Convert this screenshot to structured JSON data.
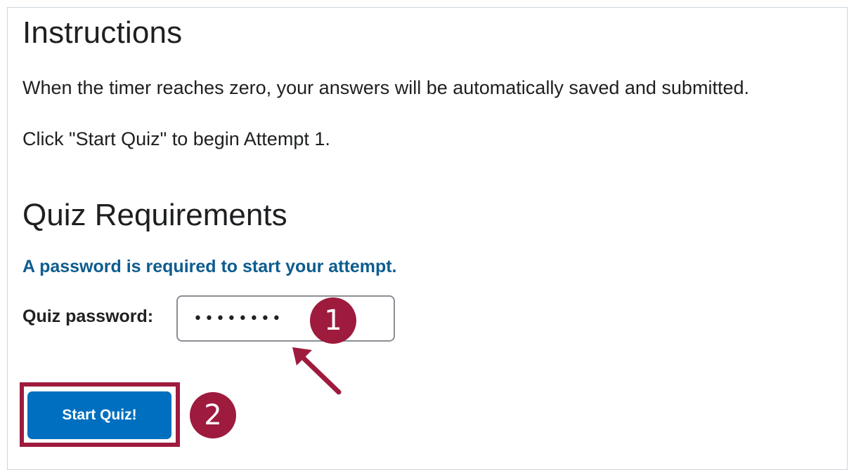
{
  "instructions": {
    "heading": "Instructions",
    "line1": "When the timer reaches zero, your answers will be automatically saved and submitted.",
    "line2": "Click \"Start Quiz\" to begin Attempt 1."
  },
  "requirements": {
    "heading": "Quiz Requirements",
    "notice": "A password is required to start your attempt.",
    "password_label": "Quiz password:",
    "password_value": "password"
  },
  "actions": {
    "start_label": "Start Quiz!"
  },
  "annotations": {
    "step1": "1",
    "step2": "2"
  },
  "colors": {
    "accent": "#006fbf",
    "notice": "#0d5c8f",
    "annotation": "#9e1b3e"
  }
}
